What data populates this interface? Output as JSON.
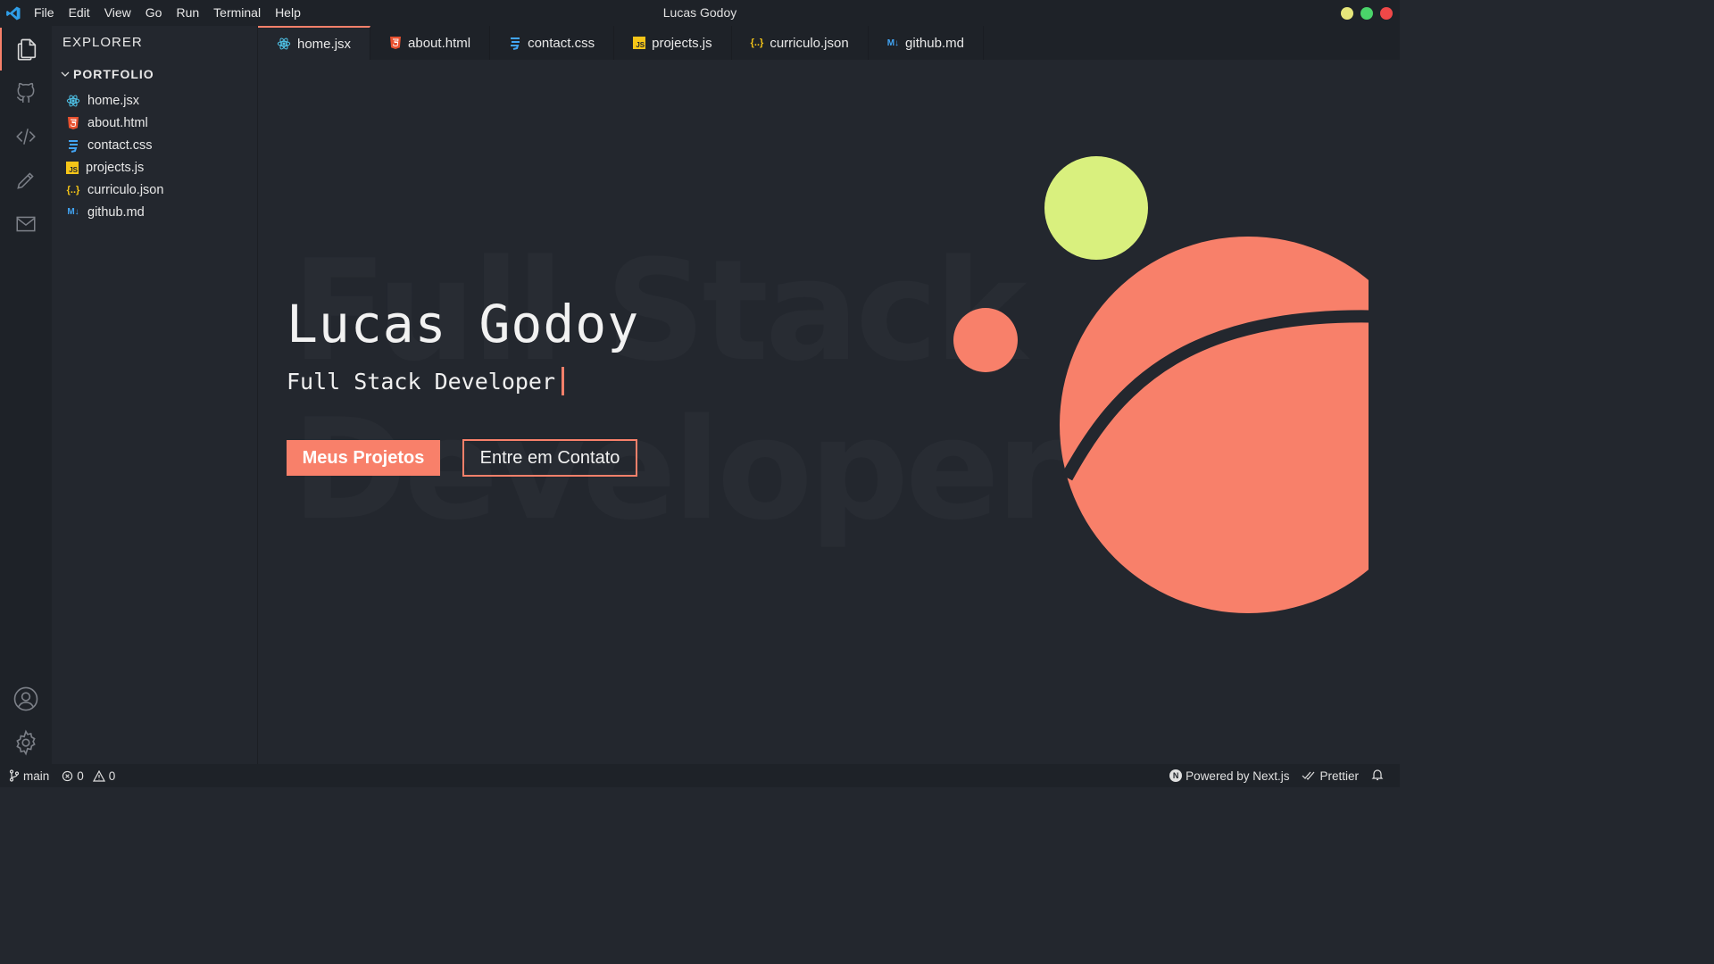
{
  "window": {
    "title": "Lucas Godoy"
  },
  "menu": [
    "File",
    "Edit",
    "View",
    "Go",
    "Run",
    "Terminal",
    "Help"
  ],
  "window_controls": {
    "minimize_color": "#e6e67a",
    "maximize_color": "#4ad46a",
    "close_color": "#f04848"
  },
  "activity_bar": {
    "items": [
      "files-icon",
      "github-icon",
      "code-icon",
      "pencil-icon",
      "mail-icon"
    ],
    "bottom": [
      "account-icon",
      "settings-icon"
    ]
  },
  "sidebar": {
    "title": "EXPLORER",
    "folder": "PORTFOLIO",
    "files": [
      {
        "name": "home.jsx",
        "icon": "react-icon"
      },
      {
        "name": "about.html",
        "icon": "html-icon"
      },
      {
        "name": "contact.css",
        "icon": "css-icon"
      },
      {
        "name": "projects.js",
        "icon": "js-icon",
        "badge": "JS"
      },
      {
        "name": "curriculo.json",
        "icon": "json-icon",
        "badge": "{..}"
      },
      {
        "name": "github.md",
        "icon": "markdown-icon",
        "badge": "M↓"
      }
    ]
  },
  "tabs": [
    {
      "label": "home.jsx",
      "active": true
    },
    {
      "label": "about.html"
    },
    {
      "label": "contact.css"
    },
    {
      "label": "projects.js"
    },
    {
      "label": "curriculo.json"
    },
    {
      "label": "github.md"
    }
  ],
  "hero": {
    "background_text_line1": "Full Stack",
    "background_text_line2": "Developer",
    "name": "Lucas Godoy",
    "role": "Full Stack Developer",
    "primary_button": "Meus Projetos",
    "secondary_button": "Entre em Contato"
  },
  "colors": {
    "accent": "#f8806a",
    "lime": "#d9f07e",
    "background": "#23272e",
    "chrome": "#1e2228"
  },
  "status_bar": {
    "branch": "main",
    "errors": "0",
    "warnings": "0",
    "powered_by": "Powered by Next.js",
    "formatter": "Prettier"
  }
}
